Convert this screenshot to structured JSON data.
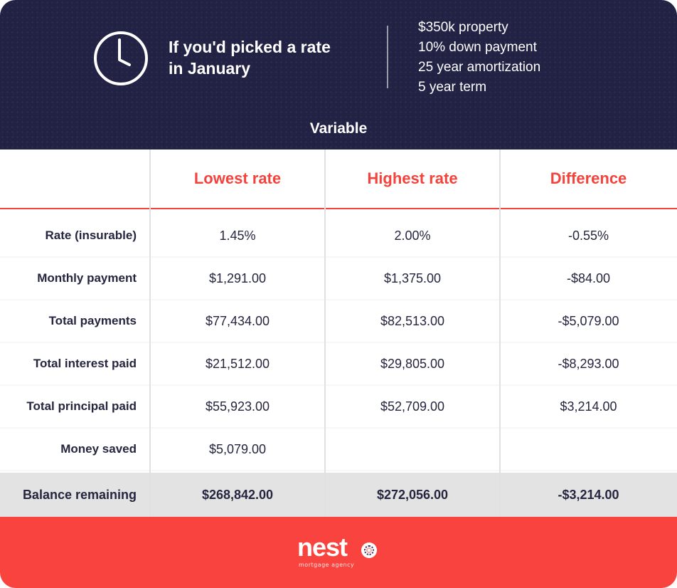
{
  "header": {
    "icon": "clock-icon",
    "title_lines": [
      "If you'd picked a rate",
      "in January"
    ],
    "specs": [
      "$350k property",
      "10% down payment",
      "25 year amortization",
      "5 year term"
    ],
    "section_label": "Variable"
  },
  "table": {
    "columns": [
      "",
      "Lowest rate",
      "Highest rate",
      "Difference"
    ],
    "rows": [
      {
        "label": "Rate (insurable)",
        "lowest": "1.45%",
        "highest": "2.00%",
        "difference": "-0.55%"
      },
      {
        "label": "Monthly payment",
        "lowest": "$1,291.00",
        "highest": "$1,375.00",
        "difference": "-$84.00"
      },
      {
        "label": "Total payments",
        "lowest": "$77,434.00",
        "highest": "$82,513.00",
        "difference": "-$5,079.00"
      },
      {
        "label": "Total interest paid",
        "lowest": "$21,512.00",
        "highest": "$29,805.00",
        "difference": "-$8,293.00"
      },
      {
        "label": "Total principal paid",
        "lowest": "$55,923.00",
        "highest": "$52,709.00",
        "difference": "$3,214.00"
      },
      {
        "label": "Money saved",
        "lowest": "$5,079.00",
        "highest": "",
        "difference": ""
      }
    ],
    "total_row": {
      "label": "Balance remaining",
      "lowest": "$268,842.00",
      "highest": "$272,056.00",
      "difference": "-$3,214.00"
    }
  },
  "footer": {
    "brand": "nest",
    "brand_badge_icon": "compass-o-icon",
    "tagline": "mortgage agency"
  },
  "colors": {
    "header_bg": "#212244",
    "accent_red": "#f2433c",
    "footer_bg": "#f8433e",
    "total_row_bg": "#e3e3e3",
    "text_dark": "#25253f"
  }
}
